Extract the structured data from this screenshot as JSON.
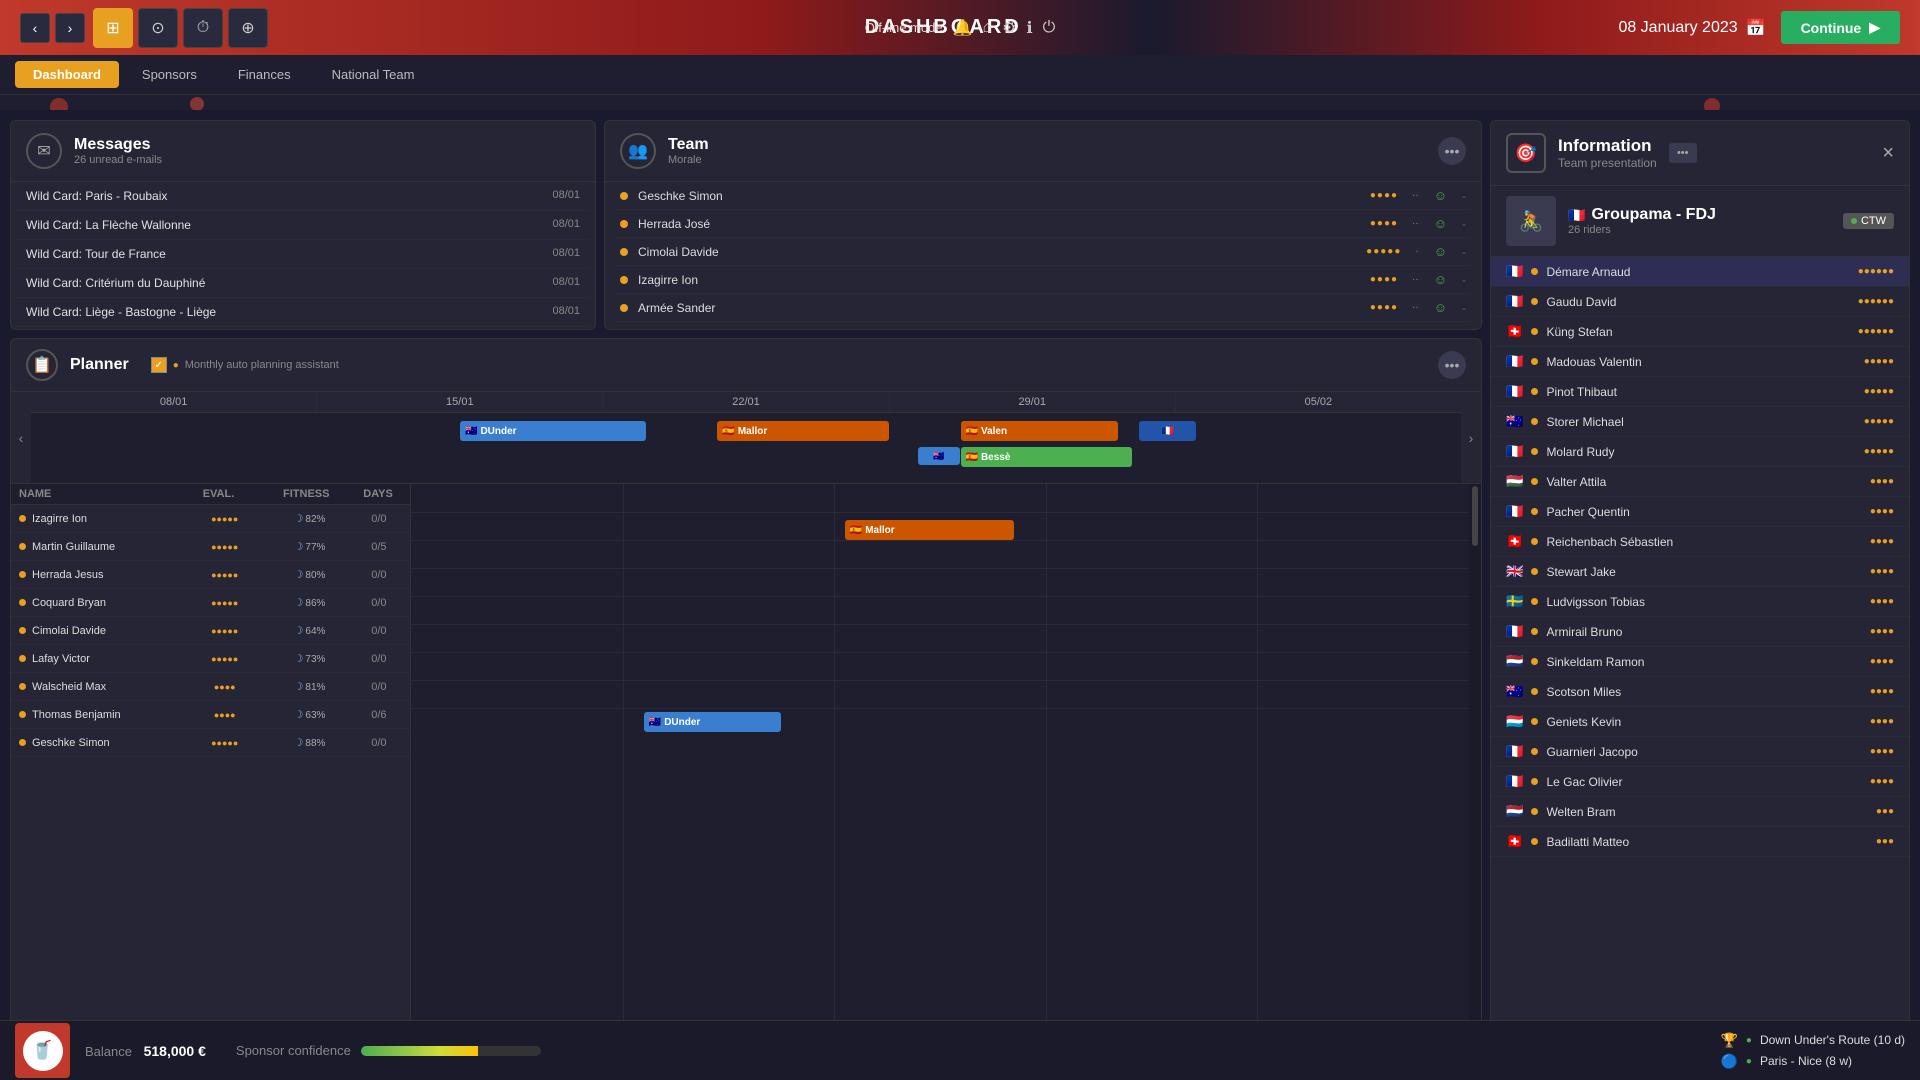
{
  "topbar": {
    "mode": "Off-line mode",
    "title": "DASHBOARD",
    "date": "08 January 2023",
    "continue_label": "Continue"
  },
  "subnav": {
    "tabs": [
      "Dashboard",
      "Sponsors",
      "Finances",
      "National Team"
    ],
    "active": "Dashboard"
  },
  "messages": {
    "title": "Messages",
    "subtitle": "26 unread e-mails",
    "items": [
      {
        "text": "Wild Card: Paris - Roubaix",
        "date": "08/01"
      },
      {
        "text": "Wild Card: La Flèche Wallonne",
        "date": "08/01"
      },
      {
        "text": "Wild Card: Tour de France",
        "date": "08/01"
      },
      {
        "text": "Wild Card: Critérium du Dauphiné",
        "date": "08/01"
      },
      {
        "text": "Wild Card: Liège - Bastogne - Liège",
        "date": "08/01"
      }
    ]
  },
  "team": {
    "title": "Team",
    "subtitle": "Morale",
    "members": [
      {
        "name": "Geschke Simon",
        "stars": "●●●●",
        "morale": "☺",
        "extra": "-"
      },
      {
        "name": "Herrada José",
        "stars": "●●●●",
        "morale": "☺",
        "extra": "-"
      },
      {
        "name": "Cimolai Davide",
        "stars": "●●●●●",
        "morale": "☺",
        "extra": "-"
      },
      {
        "name": "Izagirre Ion",
        "stars": "●●●●",
        "morale": "☺",
        "extra": "-"
      },
      {
        "name": "Armée Sander",
        "stars": "●●●●",
        "morale": "☺",
        "extra": "-"
      }
    ]
  },
  "planner": {
    "title": "Planner",
    "auto_planning": "Monthly auto planning assistant",
    "dates": [
      "08/01",
      "15/01",
      "22/01",
      "29/01",
      "05/02"
    ],
    "riders": [
      {
        "name": "Izagirre Ion",
        "eval": "●●●●●",
        "fitness": "82%",
        "days": "0/0"
      },
      {
        "name": "Martin Guillaume",
        "eval": "●●●●●",
        "fitness": "77%",
        "days": "0/5"
      },
      {
        "name": "Herrada Jesus",
        "eval": "●●●●●",
        "fitness": "80%",
        "days": "0/0"
      },
      {
        "name": "Coquard Bryan",
        "eval": "●●●●●",
        "fitness": "86%",
        "days": "0/0"
      },
      {
        "name": "Cimolai Davide",
        "eval": "●●●●●",
        "fitness": "64%",
        "days": "0/0"
      },
      {
        "name": "Lafay Victor",
        "eval": "●●●●●",
        "fitness": "73%",
        "days": "0/0"
      },
      {
        "name": "Walscheid Max",
        "eval": "●●●●",
        "fitness": "81%",
        "days": "0/0"
      },
      {
        "name": "Thomas Benjamin",
        "eval": "●●●●",
        "fitness": "63%",
        "days": "0/6"
      },
      {
        "name": "Geschke Simon",
        "eval": "●●●●●",
        "fitness": "88%",
        "days": "0/0"
      }
    ],
    "col_headers": [
      "NAME",
      "EVAL.",
      "FITNESS",
      "DAYS"
    ]
  },
  "information": {
    "title": "Information",
    "subtitle": "Team presentation",
    "team_name": "Groupama - FDJ",
    "riders_count": "26 riders",
    "ctw_label": "CTW",
    "close_label": "×",
    "riders": [
      {
        "name": "Démare Arnaud",
        "flag": "🇫🇷",
        "stars": "●●●●●●",
        "color": "#e8a020"
      },
      {
        "name": "Gaudu David",
        "flag": "🇫🇷",
        "stars": "●●●●●●",
        "color": "#e8a020"
      },
      {
        "name": "Küng Stefan",
        "flag": "🇨🇭",
        "stars": "●●●●●●",
        "color": "#e8a020"
      },
      {
        "name": "Madouas Valentin",
        "flag": "🇫🇷",
        "stars": "●●●●●",
        "color": "#e8a020"
      },
      {
        "name": "Pinot Thibaut",
        "flag": "🇫🇷",
        "stars": "●●●●●",
        "color": "#e8a020"
      },
      {
        "name": "Storer Michael",
        "flag": "🇦🇺",
        "stars": "●●●●●",
        "color": "#e8a020"
      },
      {
        "name": "Molard Rudy",
        "flag": "🇫🇷",
        "stars": "●●●●●",
        "color": "#e8a020"
      },
      {
        "name": "Valter Attila",
        "flag": "🇭🇺",
        "stars": "●●●●",
        "color": "#e8a020"
      },
      {
        "name": "Pacher Quentin",
        "flag": "🇫🇷",
        "stars": "●●●●",
        "color": "#e8a020"
      },
      {
        "name": "Reichenbach Sébastien",
        "flag": "🇨🇭",
        "stars": "●●●●",
        "color": "#e8a020"
      },
      {
        "name": "Stewart Jake",
        "flag": "🇬🇧",
        "stars": "●●●●",
        "color": "#e8a020"
      },
      {
        "name": "Ludvigsson Tobias",
        "flag": "🇸🇪",
        "stars": "●●●●",
        "color": "#e8a020"
      },
      {
        "name": "Armirail Bruno",
        "flag": "🇫🇷",
        "stars": "●●●●",
        "color": "#e8a020"
      },
      {
        "name": "Sinkeldam Ramon",
        "flag": "🇳🇱",
        "stars": "●●●●",
        "color": "#e8a020"
      },
      {
        "name": "Scotson Miles",
        "flag": "🇦🇺",
        "stars": "●●●●",
        "color": "#e8a020"
      },
      {
        "name": "Geniets Kevin",
        "flag": "🇱🇺",
        "stars": "●●●●",
        "color": "#e8a020"
      },
      {
        "name": "Guarnieri Jacopo",
        "flag": "🇫🇷",
        "stars": "●●●●",
        "color": "#e8a020"
      },
      {
        "name": "Le Gac Olivier",
        "flag": "🇫🇷",
        "stars": "●●●●",
        "color": "#e8a020"
      },
      {
        "name": "Welten Bram",
        "flag": "🇳🇱",
        "stars": "●●●",
        "color": "#e8a020"
      },
      {
        "name": "Badilatti Matteo",
        "flag": "🇨🇭",
        "stars": "●●●",
        "color": "#e8a020"
      }
    ]
  },
  "bottombar": {
    "balance_label": "Balance",
    "balance_value": "518,000 €",
    "confidence_label": "Sponsor confidence",
    "events": [
      {
        "name": "Down Under's Route (10 d)",
        "icon": "🏆"
      },
      {
        "name": "Paris - Nice (8 w)",
        "icon": "🔵"
      }
    ]
  }
}
